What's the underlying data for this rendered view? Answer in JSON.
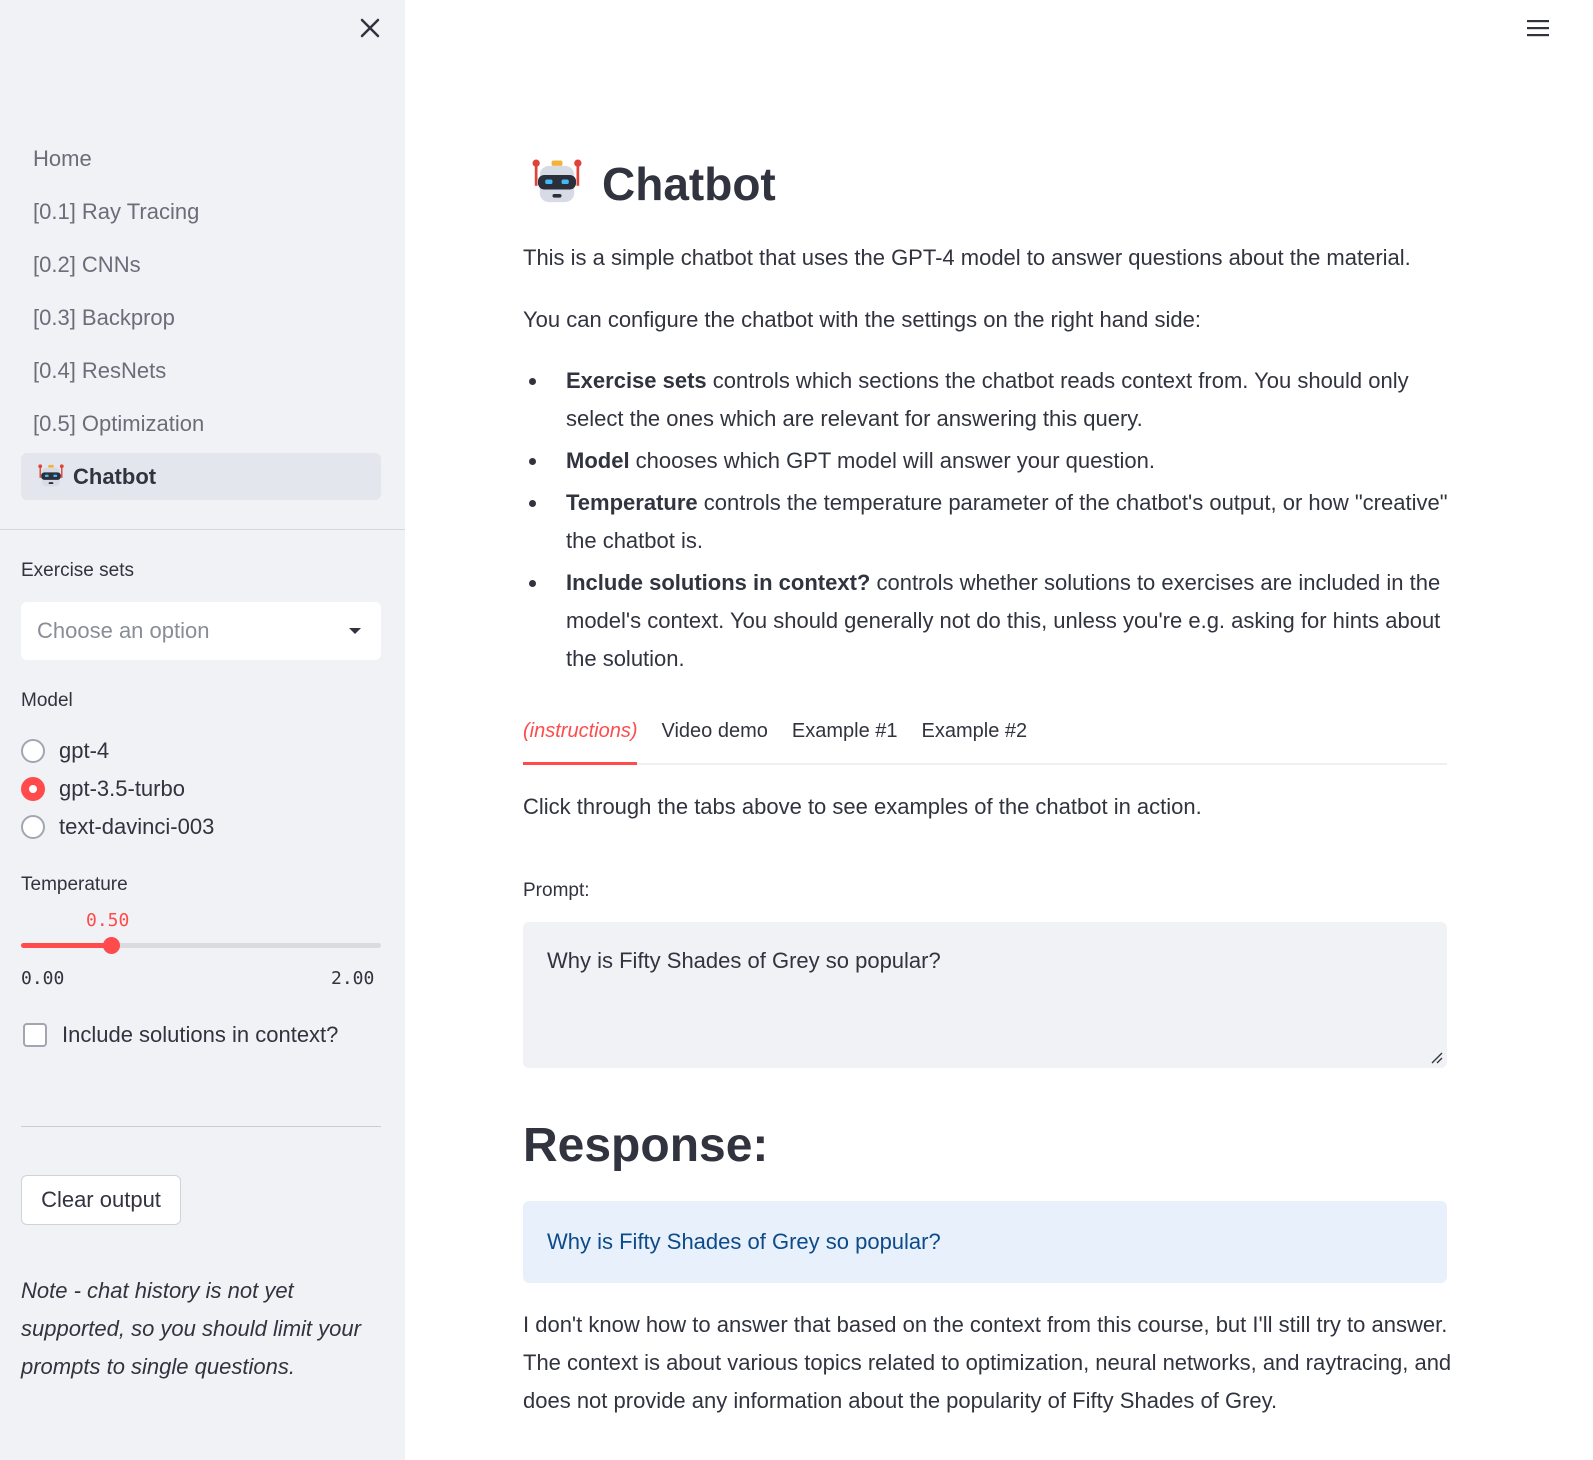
{
  "sidebar": {
    "nav": [
      {
        "label": "Home"
      },
      {
        "label": "[0.1] Ray Tracing"
      },
      {
        "label": "[0.2] CNNs"
      },
      {
        "label": "[0.3] Backprop"
      },
      {
        "label": "[0.4] ResNets"
      },
      {
        "label": "[0.5] Optimization"
      },
      {
        "label": "Chatbot",
        "active": true,
        "icon": "robot-icon"
      }
    ],
    "exercise_sets": {
      "label": "Exercise sets",
      "placeholder": "Choose an option"
    },
    "model": {
      "label": "Model",
      "options": [
        "gpt-4",
        "gpt-3.5-turbo",
        "text-davinci-003"
      ],
      "selected": "gpt-3.5-turbo"
    },
    "temperature": {
      "label": "Temperature",
      "value": "0.50",
      "min": "0.00",
      "max": "2.00",
      "fraction": 0.25
    },
    "include_solutions": {
      "label": "Include solutions in context?",
      "checked": false
    },
    "clear_button": "Clear output",
    "note": "Note - chat history is not yet supported, so you should limit your prompts to single questions."
  },
  "main": {
    "title": "Chatbot",
    "intro": "This is a simple chatbot that uses the GPT-4 model to answer questions about the material.",
    "config_text": "You can configure the chatbot with the settings on the right hand side:",
    "bullets": [
      {
        "bold": "Exercise sets",
        "text": " controls which sections the chatbot reads context from. You should only select the ones which are relevant for answering this query."
      },
      {
        "bold": "Model",
        "text": " chooses which GPT model will answer your question."
      },
      {
        "bold": "Temperature",
        "text": " controls the temperature parameter of the chatbot's output, or how \"creative\" the chatbot is."
      },
      {
        "bold": "Include solutions in context?",
        "text": " controls whether solutions to exercises are included in the model's context. You should generally not do this, unless you're e.g. asking for hints about the solution."
      }
    ],
    "tabs": [
      "(instructions)",
      "Video demo",
      "Example #1",
      "Example #2"
    ],
    "tab_text": "Click through the tabs above to see examples of the chatbot in action.",
    "prompt_label": "Prompt:",
    "prompt_value": "Why is Fifty Shades of Grey so popular?",
    "response_heading": "Response:",
    "response_question": "Why is Fifty Shades of Grey so popular?",
    "response_answer": "I don't know how to answer that based on the context from this course, but I'll still try to answer. The context is about various topics related to optimization, neural networks, and raytracing, and does not provide any information about the popularity of Fifty Shades of Grey."
  },
  "colors": {
    "accent": "#ff4b4b",
    "sidebar_bg": "#f0f2f6",
    "info_bg": "#e8f1fb",
    "info_text": "#0d4a8a"
  }
}
